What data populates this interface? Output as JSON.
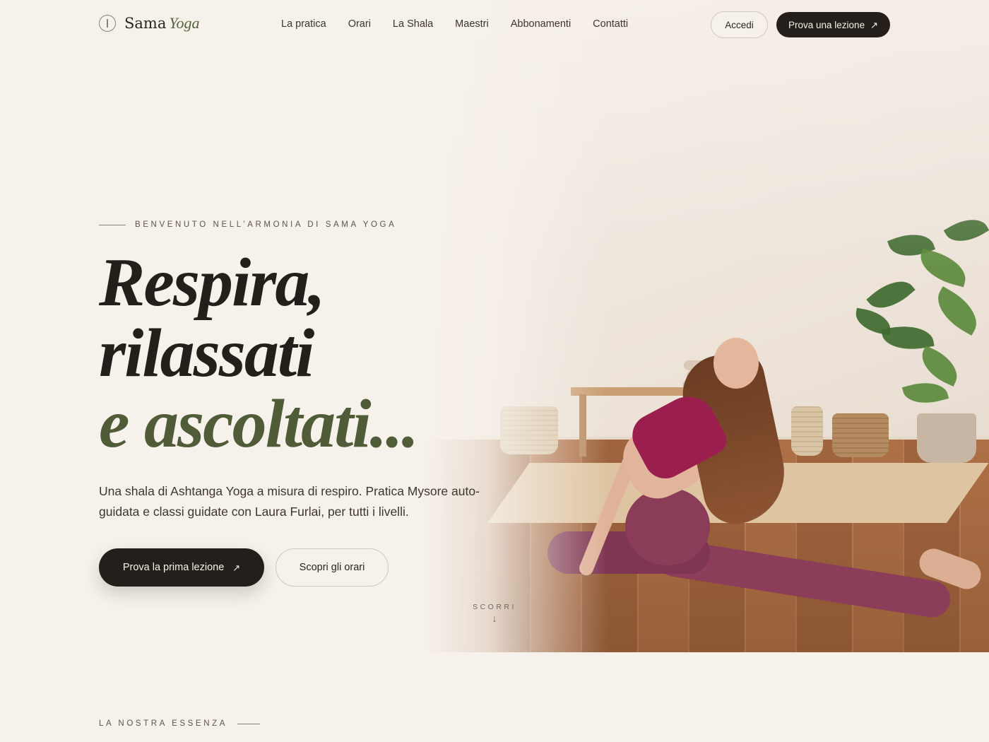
{
  "brand": {
    "name": "Sama",
    "sub": "Yoga"
  },
  "nav": {
    "items": [
      {
        "label": "La pratica"
      },
      {
        "label": "Orari"
      },
      {
        "label": "La Shala"
      },
      {
        "label": "Maestri"
      },
      {
        "label": "Abbonamenti"
      },
      {
        "label": "Contatti"
      }
    ]
  },
  "header": {
    "login_label": "Accedi",
    "try_label": "Prova una lezione",
    "try_icon": "arrow-up-right-icon"
  },
  "hero": {
    "eyebrow": "BENVENUTO NELL’ARMONIA DI SAMA YOGA",
    "title_line1": "Respira,",
    "title_line2": "rilassati",
    "title_line3": "e ascoltati...",
    "lead": "Una shala di Ashtanga Yoga a misura di respiro. Pratica Mysore auto-guidata e classi guidate con Laura Furlai, per tutti i livelli.",
    "cta_primary": "Prova la prima lezione",
    "cta_secondary": "Scopri gli orari",
    "scroll_label": "SCORRI"
  },
  "section2": {
    "eyebrow": "LA NOSTRA ESSENZA"
  },
  "colors": {
    "background": "#f6f1ea",
    "dark": "#241f1a",
    "accent_green": "#4f5c37",
    "top_magenta": "#9a1f4e"
  }
}
